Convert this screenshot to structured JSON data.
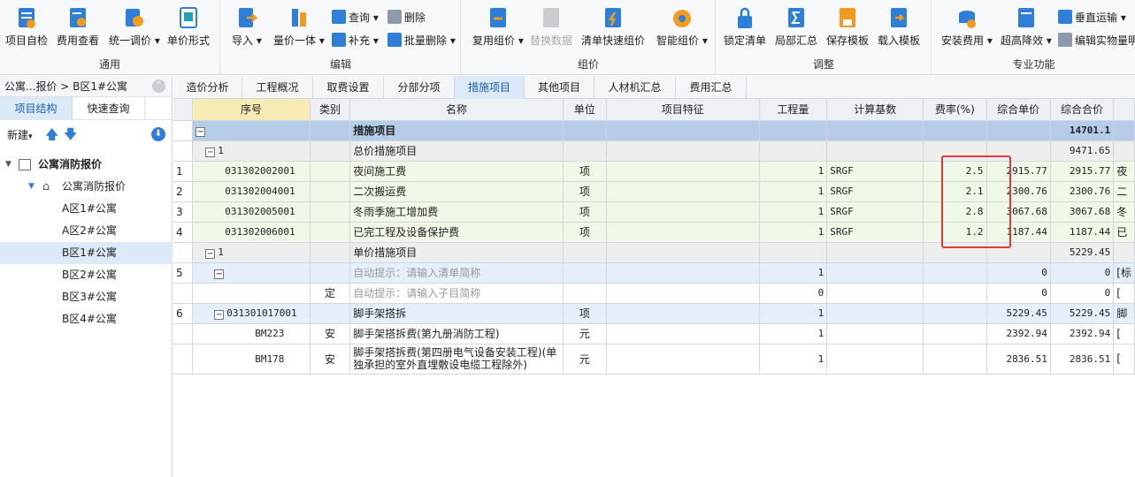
{
  "ribbon": {
    "groups": [
      {
        "label": "通用",
        "buttons": [
          "项目自检",
          "费用查看",
          "统一调价",
          "单价形式"
        ]
      },
      {
        "label": "编辑",
        "buttons": [
          "导入",
          "量价一体",
          "查询",
          "补充",
          "删除",
          "批量删除"
        ]
      },
      {
        "label": "组价",
        "buttons": [
          "复用组价",
          "替换数据",
          "清单快速组价",
          "智能组价"
        ]
      },
      {
        "label": "调整",
        "buttons": [
          "锁定清单",
          "局部汇总",
          "保存模板",
          "载入模板"
        ]
      },
      {
        "label": "专业功能",
        "buttons": [
          "安装费用",
          "超高降效",
          "垂直运输",
          "编辑实物量明"
        ]
      }
    ]
  },
  "left": {
    "breadcrumb": "公寓...报价 > B区1#公寓",
    "tabs": [
      "项目结构",
      "快速查询"
    ],
    "new_label": "新建",
    "tree": [
      {
        "label": "公寓消防报价"
      },
      {
        "label": "公寓消防报价"
      },
      {
        "label": "A区1#公寓"
      },
      {
        "label": "A区2#公寓"
      },
      {
        "label": "B区1#公寓"
      },
      {
        "label": "B区2#公寓"
      },
      {
        "label": "B区3#公寓"
      },
      {
        "label": "B区4#公寓"
      }
    ]
  },
  "main_tabs": [
    "造价分析",
    "工程概况",
    "取费设置",
    "分部分项",
    "措施项目",
    "其他项目",
    "人材机汇总",
    "费用汇总"
  ],
  "table": {
    "headers": [
      "序号",
      "类别",
      "名称",
      "单位",
      "项目特征",
      "工程量",
      "计算基数",
      "费率(%)",
      "综合单价",
      "综合合价"
    ],
    "rows": [
      {
        "rn": "",
        "seq": "",
        "cat": "",
        "name": "措施项目",
        "unit": "",
        "qty": "",
        "base": "",
        "rate": "",
        "price": "",
        "total": "14701.1",
        "extra": ""
      },
      {
        "rn": "",
        "seq": "1",
        "cat": "",
        "name": "总价措施项目",
        "unit": "",
        "qty": "",
        "base": "",
        "rate": "",
        "price": "",
        "total": "9471.65",
        "extra": ""
      },
      {
        "rn": "1",
        "seq": "031302002001",
        "cat": "",
        "name": "夜间施工费",
        "unit": "项",
        "qty": "1",
        "base": "SRGF",
        "rate": "2.5",
        "price": "2915.77",
        "total": "2915.77",
        "extra": "夜"
      },
      {
        "rn": "2",
        "seq": "031302004001",
        "cat": "",
        "name": "二次搬运费",
        "unit": "项",
        "qty": "1",
        "base": "SRGF",
        "rate": "2.1",
        "price": "2300.76",
        "total": "2300.76",
        "extra": "二"
      },
      {
        "rn": "3",
        "seq": "031302005001",
        "cat": "",
        "name": "冬雨季施工增加费",
        "unit": "项",
        "qty": "1",
        "base": "SRGF",
        "rate": "2.8",
        "price": "3067.68",
        "total": "3067.68",
        "extra": "冬"
      },
      {
        "rn": "4",
        "seq": "031302006001",
        "cat": "",
        "name": "已完工程及设备保护费",
        "unit": "项",
        "qty": "1",
        "base": "SRGF",
        "rate": "1.2",
        "price": "1187.44",
        "total": "1187.44",
        "extra": "已"
      },
      {
        "rn": "",
        "seq": "1",
        "cat": "",
        "name": "单价措施项目",
        "unit": "",
        "qty": "",
        "base": "",
        "rate": "",
        "price": "",
        "total": "5229.45",
        "extra": ""
      },
      {
        "rn": "5",
        "seq": "",
        "cat": "",
        "name": "自动提示：请输入清单简称",
        "unit": "",
        "qty": "1",
        "base": "",
        "rate": "",
        "price": "0",
        "total": "0",
        "extra": "[标"
      },
      {
        "rn": "",
        "seq": "",
        "cat": "定",
        "name": "自动提示：请输入子目简称",
        "unit": "",
        "qty": "0",
        "base": "",
        "rate": "",
        "price": "0",
        "total": "0",
        "extra": "["
      },
      {
        "rn": "6",
        "seq": "031301017001",
        "cat": "",
        "name": "脚手架搭拆",
        "unit": "项",
        "qty": "1",
        "base": "",
        "rate": "",
        "price": "5229.45",
        "total": "5229.45",
        "extra": "脚"
      },
      {
        "rn": "",
        "seq": "BM223",
        "cat": "安",
        "name": "脚手架搭拆费(第九册消防工程)",
        "unit": "元",
        "qty": "1",
        "base": "",
        "rate": "",
        "price": "2392.94",
        "total": "2392.94",
        "extra": "["
      },
      {
        "rn": "",
        "seq": "BM178",
        "cat": "安",
        "name": "脚手架搭拆费(第四册电气设备安装工程)(单独承担的室外直埋敷设电缆工程除外)",
        "unit": "元",
        "qty": "1",
        "base": "",
        "rate": "",
        "price": "2836.51",
        "total": "2836.51",
        "extra": "["
      }
    ]
  }
}
